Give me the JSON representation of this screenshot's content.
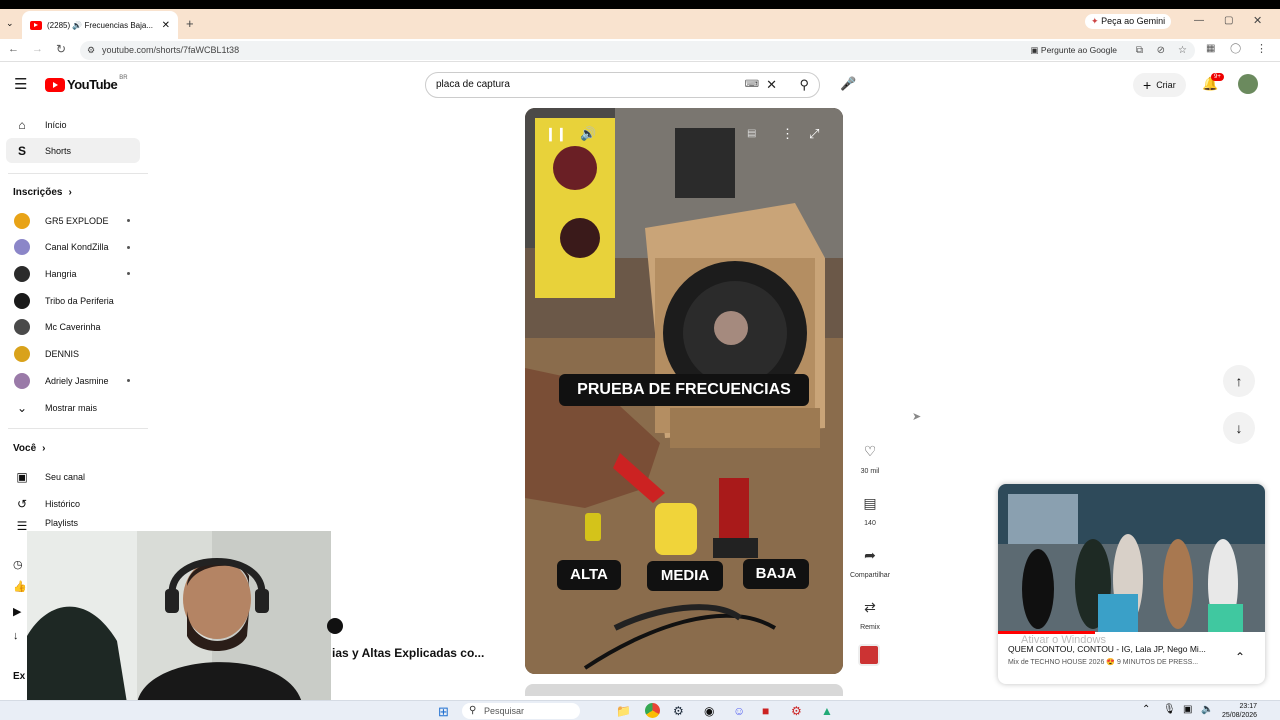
{
  "browser": {
    "tab_title": "(2285) 🔊 Frecuencias Baja...",
    "url": "youtube.com/shorts/7faWCBL1t38",
    "gemini_label": "Peça ao Gemini",
    "ask_google": "Pergunte ao Google"
  },
  "youtube": {
    "logo_text": "YouTube",
    "region": "BR",
    "search_value": "placa de captura",
    "create_label": "Criar",
    "notif_count": "9+"
  },
  "sidebar": {
    "home": "Início",
    "shorts": "Shorts",
    "subs_title": "Inscrições",
    "channels": [
      {
        "name": "GR5 EXPLODE",
        "color": "#e8a317",
        "dot": true
      },
      {
        "name": "Canal KondZilla",
        "color": "#8b86c8",
        "dot": true
      },
      {
        "name": "Hangria",
        "color": "#2b2b2b",
        "dot": true
      },
      {
        "name": "Tribo da Periferia",
        "color": "#1a1a1a",
        "dot": false
      },
      {
        "name": "Mc Caverinha",
        "color": "#4a4a4a",
        "dot": false
      },
      {
        "name": "DENNIS",
        "color": "#d9a21b",
        "dot": false
      },
      {
        "name": "Adriely Jasmine",
        "color": "#9a7aa8",
        "dot": true
      }
    ],
    "show_more": "Mostrar mais",
    "you_title": "Você",
    "you_items": [
      "Seu canal",
      "Histórico",
      "Playlists"
    ]
  },
  "video": {
    "title_overlay": "PRUEBA DE FRECUENCIAS",
    "label_alta": "ALTA",
    "label_media": "MEDIA",
    "label_baja": "BAJA",
    "partial_title": "ias y Altas Explicadas co..."
  },
  "actions": {
    "likes": "30 mil",
    "comments": "140",
    "share": "Compartilhar",
    "remix": "Remix"
  },
  "miniplayer": {
    "title": "QUEM CONTOU, CONTOU - IG, Lala JP, Nego Mi...",
    "subtitle": "Mix de TECHNO HOUSE 2026 😍 9 MINUTOS DE PRESS...",
    "watermark1": "Ativar o Windows",
    "watermark2": "Acesse Configurações para ativar o Windows."
  },
  "taskbar": {
    "search_placeholder": "Pesquisar",
    "time": "23:17",
    "date": "25/08/2026"
  },
  "colors": {
    "tabstrip": "#f9e3cf",
    "accent_red": "#ff0000"
  }
}
